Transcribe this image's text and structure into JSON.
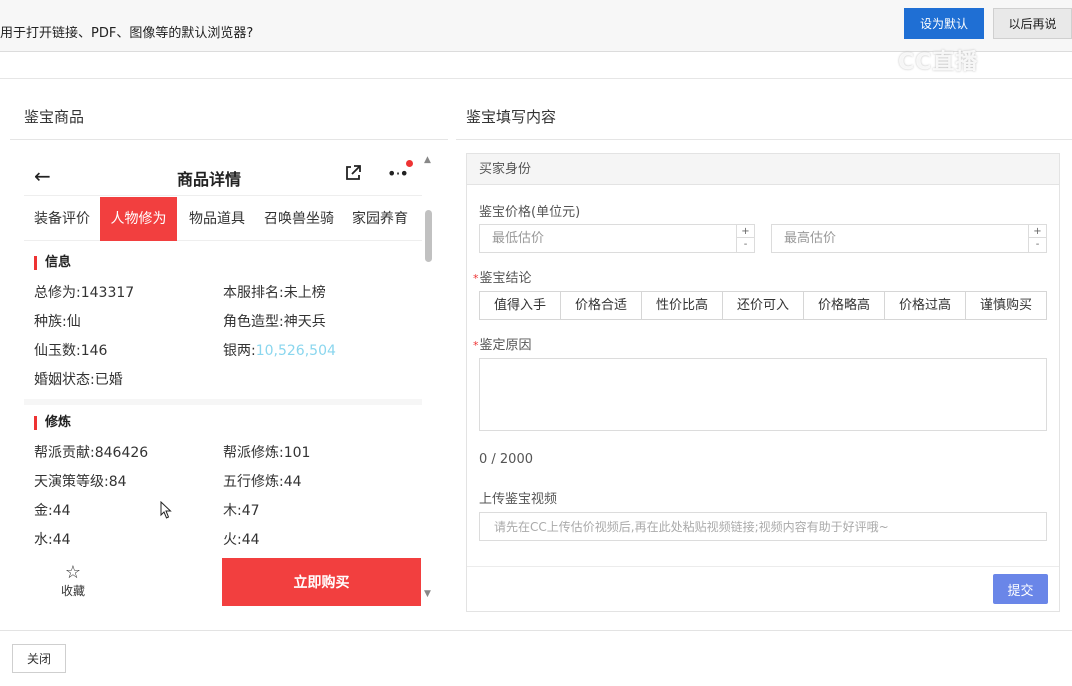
{
  "browser_prompt": {
    "message": "用于打开链接、PDF、图像等的默认浏览器?",
    "set_default_label": "设为默认",
    "later_label": "以后再说"
  },
  "watermark": {
    "text": "CC直播"
  },
  "left_panel": {
    "title": "鉴宝商品"
  },
  "right_panel": {
    "title": "鉴宝填写内容"
  },
  "phone": {
    "header": {
      "back_icon": "arrow-left-icon",
      "title": "商品详情",
      "share_icon": "share-external-icon",
      "more_icon": "more-dots-icon"
    },
    "tabs": [
      {
        "label": "装备评价",
        "active": false
      },
      {
        "label": "人物修为",
        "active": true
      },
      {
        "label": "物品道具",
        "active": false
      },
      {
        "label": "召唤兽坐骑",
        "active": false
      },
      {
        "label": "家园养育",
        "active": false
      }
    ],
    "info": {
      "heading": "信息",
      "rows": [
        {
          "k1": "总修为:",
          "v1": "143317",
          "k2": "本服排名:",
          "v2": "未上榜"
        },
        {
          "k1": "种族:",
          "v1": "仙",
          "k2": "角色造型:",
          "v2": "神天兵"
        },
        {
          "k1": "仙玉数:",
          "v1": "146",
          "k2": "银两:",
          "v2": "10,526,504"
        },
        {
          "k1": "婚姻状态:",
          "v1": "已婚"
        }
      ]
    },
    "cultivation": {
      "heading": "修炼",
      "rows": [
        {
          "k1": "帮派贡献:",
          "v1": "846426",
          "k2": "帮派修炼:",
          "v2": "101"
        },
        {
          "k1": "天演策等级:",
          "v1": "84",
          "k2": "五行修炼:",
          "v2": "44"
        },
        {
          "k1": "金:",
          "v1": "44",
          "k2": "木:",
          "v2": "47"
        },
        {
          "k1": "水:",
          "v1": "44",
          "k2": "火:",
          "v2": "44"
        }
      ]
    },
    "footer": {
      "favorite_label": "收藏",
      "buy_label": "立即购买"
    }
  },
  "form": {
    "section_header": "买家身份",
    "price_label": "鉴宝价格(单位元)",
    "min_placeholder": "最低估价",
    "max_placeholder": "最高估价",
    "conclusion_label": "鉴宝结论",
    "conclusions": [
      "值得入手",
      "价格合适",
      "性价比高",
      "还价可入",
      "价格略高",
      "价格过高",
      "谨慎购买"
    ],
    "reason_label": "鉴定原因",
    "counter": "0 / 2000",
    "video_label": "上传鉴宝视频",
    "video_placeholder": "请先在CC上传估价视频后,再在此处粘贴视频链接;视频内容有助于好评哦~",
    "submit_label": "提交"
  },
  "close_label": "关闭",
  "colors": {
    "accent_red": "#f23f3f",
    "primary_blue": "#1f6fd4",
    "submit_blue": "#6a86e8",
    "silver_value": "#8ad6ee"
  }
}
